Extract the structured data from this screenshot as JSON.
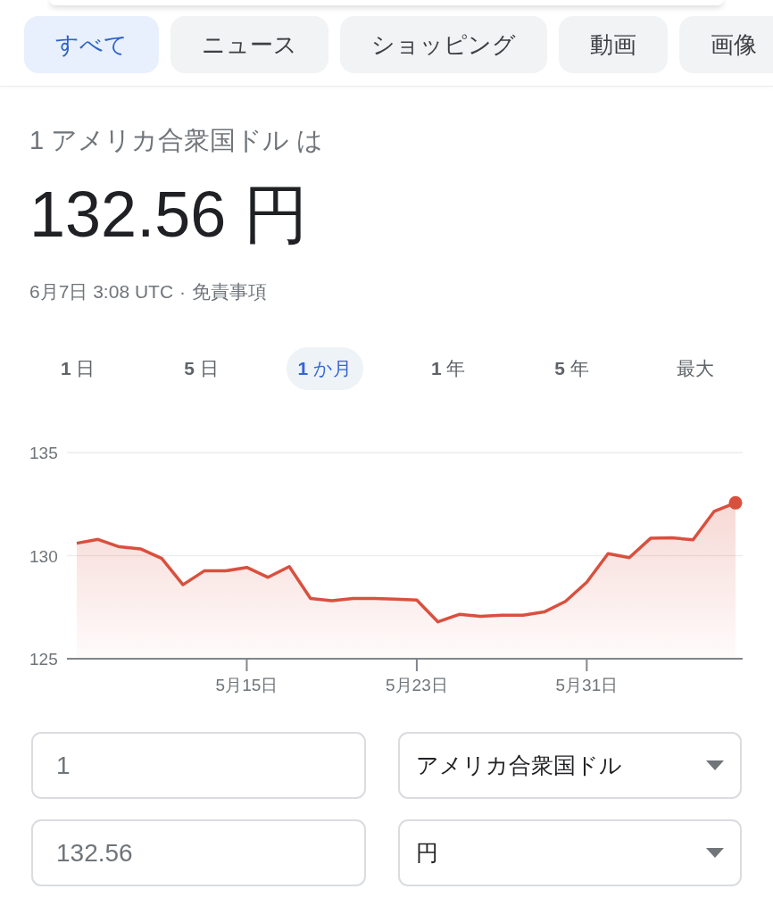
{
  "search_tabs": [
    {
      "label": "すべて",
      "selected": true
    },
    {
      "label": "ニュース",
      "selected": false
    },
    {
      "label": "ショッピング",
      "selected": false
    },
    {
      "label": "動画",
      "selected": false
    },
    {
      "label": "画像",
      "selected": false
    }
  ],
  "result": {
    "subtitle": "1 アメリカ合衆国ドル は",
    "value": "132.56 円",
    "timestamp": "6月7日 3:08 UTC",
    "separator": "·",
    "disclaimer_link": "免責事項"
  },
  "ranges": [
    {
      "label": "**1** 日",
      "selected": false
    },
    {
      "label": "**5** 日",
      "selected": false
    },
    {
      "label": "**1** か月",
      "selected": true
    },
    {
      "label": "**1** 年",
      "selected": false
    },
    {
      "label": "**5** 年",
      "selected": false
    },
    {
      "label": "最大",
      "selected": false
    }
  ],
  "chart": {
    "chart_data": {
      "type": "area",
      "categories": [
        null,
        null,
        null,
        null,
        null,
        null,
        null,
        null,
        "5月15日",
        null,
        null,
        null,
        null,
        null,
        null,
        null,
        "5月23日",
        null,
        null,
        null,
        null,
        null,
        null,
        null,
        "5月31日",
        null,
        null,
        null,
        null,
        null,
        null,
        null
      ],
      "series": [
        {
          "color": "#d9503f",
          "values": [
            130.6,
            130.79,
            130.43,
            130.33,
            129.86,
            128.59,
            129.26,
            129.26,
            129.43,
            128.95,
            129.47,
            127.92,
            127.82,
            127.92,
            127.92,
            127.89,
            127.85,
            126.79,
            127.15,
            127.06,
            127.11,
            127.11,
            127.27,
            127.78,
            128.71,
            130.1,
            129.9,
            130.84,
            130.86,
            130.77,
            132.15,
            132.56
          ]
        }
      ],
      "ylim": [
        125,
        135
      ],
      "yticks": [
        125,
        130,
        135
      ]
    }
  },
  "converter": {
    "rows": [
      {
        "amount": "1",
        "currency": "アメリカ合衆国ドル"
      },
      {
        "amount": "132.56",
        "currency": "円"
      }
    ]
  }
}
